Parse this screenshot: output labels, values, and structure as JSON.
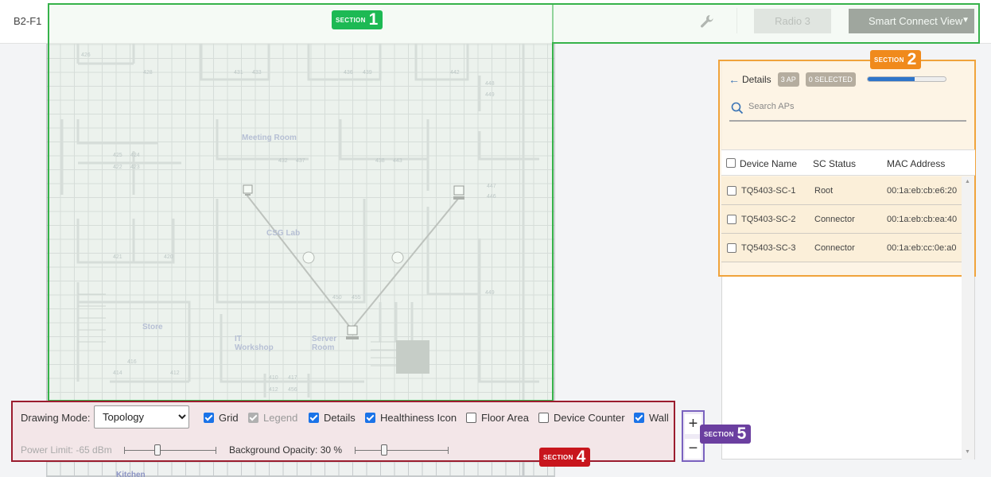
{
  "header": {
    "floor_name": "B2-F1",
    "radio_button": "Radio 3",
    "view_button": "Smart Connect View",
    "view_caret": "▼"
  },
  "sections": {
    "s1": {
      "label": "SECTION",
      "number": "1",
      "color": "#1db954"
    },
    "s2": {
      "label": "SECTION",
      "number": "2",
      "color": "#f08a1c"
    },
    "s4": {
      "label": "SECTION",
      "number": "4",
      "color": "#c8161d"
    },
    "s5": {
      "label": "SECTION",
      "number": "5",
      "color": "#6b3fa0"
    }
  },
  "floorplan": {
    "rooms": {
      "meeting": "Meeting Room",
      "csg_lab": "CSG Lab",
      "store": "Store",
      "it_workshop": "IT Workshop",
      "server_room": "Server Room",
      "kitchen": "Kitchen"
    },
    "numbers": [
      "426",
      "428",
      "431",
      "433",
      "436",
      "439",
      "442",
      "448",
      "449",
      "425",
      "424",
      "422",
      "423",
      "432",
      "437",
      "438",
      "443",
      "447",
      "446",
      "421",
      "420",
      "450",
      "455",
      "449",
      "416",
      "414",
      "412",
      "410",
      "417",
      "412",
      "456"
    ]
  },
  "details": {
    "back_icon": "←",
    "title": "Details",
    "ap_count": "3 AP",
    "selected": "0 SELECTED",
    "progress": 0.6,
    "search_placeholder": "Search APs"
  },
  "table": {
    "headers": [
      "Device Name",
      "SC Status",
      "MAC Address"
    ],
    "rows": [
      {
        "name": "TQ5403-SC-1",
        "status": "Root",
        "mac": "00:1a:eb:cb:e6:20"
      },
      {
        "name": "TQ5403-SC-2",
        "status": "Connector",
        "mac": "00:1a:eb:cb:ea:40"
      },
      {
        "name": "TQ5403-SC-3",
        "status": "Connector",
        "mac": "00:1a:eb:cc:0e:a0"
      }
    ]
  },
  "controls": {
    "drawing_mode_label": "Drawing Mode:",
    "drawing_mode_value": "Topology",
    "checkboxes": [
      {
        "label": "Grid",
        "checked": true
      },
      {
        "label": "Legend",
        "checked": true,
        "disabled": true
      },
      {
        "label": "Details",
        "checked": true
      },
      {
        "label": "Healthiness Icon",
        "checked": true
      },
      {
        "label": "Floor Area",
        "checked": false
      },
      {
        "label": "Device Counter",
        "checked": false
      },
      {
        "label": "Wall",
        "checked": true
      }
    ],
    "power_limit": "Power Limit: -65 dBm",
    "bg_opacity": "Background Opacity: 30 %"
  },
  "zoom": {
    "in": "+",
    "out": "−"
  }
}
